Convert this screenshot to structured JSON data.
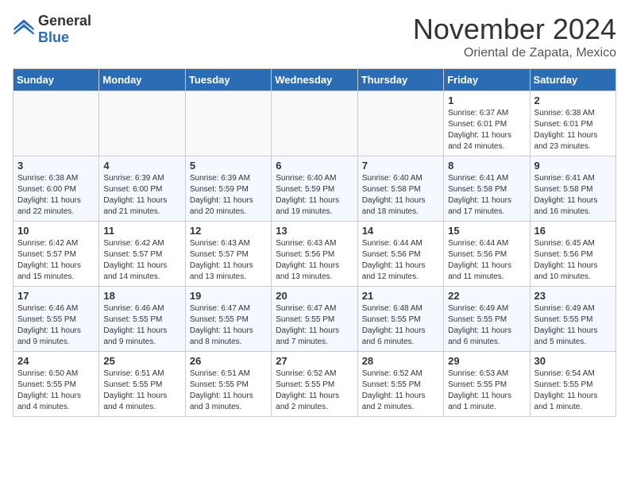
{
  "header": {
    "logo_general": "General",
    "logo_blue": "Blue",
    "month_title": "November 2024",
    "location": "Oriental de Zapata, Mexico"
  },
  "days_of_week": [
    "Sunday",
    "Monday",
    "Tuesday",
    "Wednesday",
    "Thursday",
    "Friday",
    "Saturday"
  ],
  "weeks": [
    [
      {
        "day": "",
        "empty": true
      },
      {
        "day": "",
        "empty": true
      },
      {
        "day": "",
        "empty": true
      },
      {
        "day": "",
        "empty": true
      },
      {
        "day": "",
        "empty": true
      },
      {
        "day": "1",
        "sunrise": "Sunrise: 6:37 AM",
        "sunset": "Sunset: 6:01 PM",
        "daylight": "Daylight: 11 hours and 24 minutes."
      },
      {
        "day": "2",
        "sunrise": "Sunrise: 6:38 AM",
        "sunset": "Sunset: 6:01 PM",
        "daylight": "Daylight: 11 hours and 23 minutes."
      }
    ],
    [
      {
        "day": "3",
        "sunrise": "Sunrise: 6:38 AM",
        "sunset": "Sunset: 6:00 PM",
        "daylight": "Daylight: 11 hours and 22 minutes."
      },
      {
        "day": "4",
        "sunrise": "Sunrise: 6:39 AM",
        "sunset": "Sunset: 6:00 PM",
        "daylight": "Daylight: 11 hours and 21 minutes."
      },
      {
        "day": "5",
        "sunrise": "Sunrise: 6:39 AM",
        "sunset": "Sunset: 5:59 PM",
        "daylight": "Daylight: 11 hours and 20 minutes."
      },
      {
        "day": "6",
        "sunrise": "Sunrise: 6:40 AM",
        "sunset": "Sunset: 5:59 PM",
        "daylight": "Daylight: 11 hours and 19 minutes."
      },
      {
        "day": "7",
        "sunrise": "Sunrise: 6:40 AM",
        "sunset": "Sunset: 5:58 PM",
        "daylight": "Daylight: 11 hours and 18 minutes."
      },
      {
        "day": "8",
        "sunrise": "Sunrise: 6:41 AM",
        "sunset": "Sunset: 5:58 PM",
        "daylight": "Daylight: 11 hours and 17 minutes."
      },
      {
        "day": "9",
        "sunrise": "Sunrise: 6:41 AM",
        "sunset": "Sunset: 5:58 PM",
        "daylight": "Daylight: 11 hours and 16 minutes."
      }
    ],
    [
      {
        "day": "10",
        "sunrise": "Sunrise: 6:42 AM",
        "sunset": "Sunset: 5:57 PM",
        "daylight": "Daylight: 11 hours and 15 minutes."
      },
      {
        "day": "11",
        "sunrise": "Sunrise: 6:42 AM",
        "sunset": "Sunset: 5:57 PM",
        "daylight": "Daylight: 11 hours and 14 minutes."
      },
      {
        "day": "12",
        "sunrise": "Sunrise: 6:43 AM",
        "sunset": "Sunset: 5:57 PM",
        "daylight": "Daylight: 11 hours and 13 minutes."
      },
      {
        "day": "13",
        "sunrise": "Sunrise: 6:43 AM",
        "sunset": "Sunset: 5:56 PM",
        "daylight": "Daylight: 11 hours and 13 minutes."
      },
      {
        "day": "14",
        "sunrise": "Sunrise: 6:44 AM",
        "sunset": "Sunset: 5:56 PM",
        "daylight": "Daylight: 11 hours and 12 minutes."
      },
      {
        "day": "15",
        "sunrise": "Sunrise: 6:44 AM",
        "sunset": "Sunset: 5:56 PM",
        "daylight": "Daylight: 11 hours and 11 minutes."
      },
      {
        "day": "16",
        "sunrise": "Sunrise: 6:45 AM",
        "sunset": "Sunset: 5:56 PM",
        "daylight": "Daylight: 11 hours and 10 minutes."
      }
    ],
    [
      {
        "day": "17",
        "sunrise": "Sunrise: 6:46 AM",
        "sunset": "Sunset: 5:55 PM",
        "daylight": "Daylight: 11 hours and 9 minutes."
      },
      {
        "day": "18",
        "sunrise": "Sunrise: 6:46 AM",
        "sunset": "Sunset: 5:55 PM",
        "daylight": "Daylight: 11 hours and 9 minutes."
      },
      {
        "day": "19",
        "sunrise": "Sunrise: 6:47 AM",
        "sunset": "Sunset: 5:55 PM",
        "daylight": "Daylight: 11 hours and 8 minutes."
      },
      {
        "day": "20",
        "sunrise": "Sunrise: 6:47 AM",
        "sunset": "Sunset: 5:55 PM",
        "daylight": "Daylight: 11 hours and 7 minutes."
      },
      {
        "day": "21",
        "sunrise": "Sunrise: 6:48 AM",
        "sunset": "Sunset: 5:55 PM",
        "daylight": "Daylight: 11 hours and 6 minutes."
      },
      {
        "day": "22",
        "sunrise": "Sunrise: 6:49 AM",
        "sunset": "Sunset: 5:55 PM",
        "daylight": "Daylight: 11 hours and 6 minutes."
      },
      {
        "day": "23",
        "sunrise": "Sunrise: 6:49 AM",
        "sunset": "Sunset: 5:55 PM",
        "daylight": "Daylight: 11 hours and 5 minutes."
      }
    ],
    [
      {
        "day": "24",
        "sunrise": "Sunrise: 6:50 AM",
        "sunset": "Sunset: 5:55 PM",
        "daylight": "Daylight: 11 hours and 4 minutes."
      },
      {
        "day": "25",
        "sunrise": "Sunrise: 6:51 AM",
        "sunset": "Sunset: 5:55 PM",
        "daylight": "Daylight: 11 hours and 4 minutes."
      },
      {
        "day": "26",
        "sunrise": "Sunrise: 6:51 AM",
        "sunset": "Sunset: 5:55 PM",
        "daylight": "Daylight: 11 hours and 3 minutes."
      },
      {
        "day": "27",
        "sunrise": "Sunrise: 6:52 AM",
        "sunset": "Sunset: 5:55 PM",
        "daylight": "Daylight: 11 hours and 2 minutes."
      },
      {
        "day": "28",
        "sunrise": "Sunrise: 6:52 AM",
        "sunset": "Sunset: 5:55 PM",
        "daylight": "Daylight: 11 hours and 2 minutes."
      },
      {
        "day": "29",
        "sunrise": "Sunrise: 6:53 AM",
        "sunset": "Sunset: 5:55 PM",
        "daylight": "Daylight: 11 hours and 1 minute."
      },
      {
        "day": "30",
        "sunrise": "Sunrise: 6:54 AM",
        "sunset": "Sunset: 5:55 PM",
        "daylight": "Daylight: 11 hours and 1 minute."
      }
    ]
  ]
}
